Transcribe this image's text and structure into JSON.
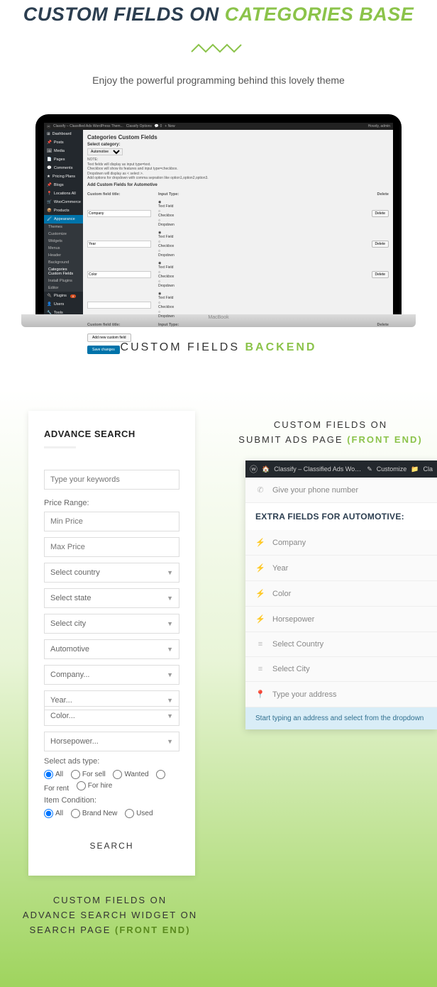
{
  "hero": {
    "title_prefix": "CUSTOM FIELDS ON ",
    "title_suffix": "CATEGORIES BASE",
    "subtitle": "Enjoy the powerful programming behind this lovely theme"
  },
  "laptop": {
    "macbook": "MacBook",
    "howdy": "Howdy, admin",
    "site": "Classify – Classified Ads WordPress Them...",
    "opts": "Classify Options",
    "new": "New",
    "sidebar": [
      "Dashboard",
      "Posts",
      "Media",
      "Pages",
      "Comments",
      "Pricing Plans",
      "Blogs",
      "Locations All",
      "WooCommerce",
      "Products",
      "Appearance"
    ],
    "submenu": [
      "Themes",
      "Customize",
      "Widgets",
      "Menus",
      "Header",
      "Background",
      "Categories Custom Fields",
      "Install Plugins",
      "Editor"
    ],
    "sidebar2": [
      "Plugins",
      "Users",
      "Tools"
    ],
    "page_title": "Categories Custom Fields",
    "select_cat": "Select category:",
    "cat_value": "Automotive",
    "note_head": "NOTE:",
    "note1": "Text fields will display as input type=text.",
    "note2": "Checkbox will show its features and input type=checkbox.",
    "note3": "Dropdown will display as < select >.",
    "note4": "Add options for dropdown with comma sepration like option1,option2,option3.",
    "add_head": "Add Custom Fields for Automotive",
    "th1": "Custom field title:",
    "th2": "Input Type:",
    "th3": "Delete",
    "rows": [
      {
        "title": "Company"
      },
      {
        "title": "Year"
      },
      {
        "title": "Color"
      },
      {
        "title": "Custom field title:"
      }
    ],
    "opt_text": "Text Field",
    "opt_chk": "Checkbox",
    "opt_dd": "Dropdown",
    "input_type": "Input Type:",
    "delete": "Delete",
    "add_btn": "Add new custom field",
    "save_btn": "Save changes"
  },
  "cap1": {
    "prefix": "CUSTOM FIELDS ",
    "suffix": "BACKEND"
  },
  "search": {
    "title": "ADVANCE SEARCH",
    "kw_ph": "Type your keywords",
    "pr_label": "Price Range:",
    "min_ph": "Min Price",
    "max_ph": "Max Price",
    "selects": [
      "Select country",
      "Select state",
      "Select city",
      "Automotive",
      "Company...",
      "Year...",
      "Color...",
      "Horsepower..."
    ],
    "ads_type": "Select ads type:",
    "ads_opts": [
      "All",
      "For sell",
      "Wanted",
      "For rent",
      "For hire"
    ],
    "cond_label": "Item Condition:",
    "cond_opts": [
      "All",
      "Brand New",
      "Used"
    ],
    "btn": "SEARCH"
  },
  "cap2": {
    "l1": "CUSTOM FIELDS ON",
    "l2": "ADVANCE SEARCH WIDGET ON",
    "l3": "SEARCH PAGE ",
    "suffix": "(FRONT END)"
  },
  "cap3": {
    "l1": "CUSTOM FIELDS ON",
    "l2": "SUBMIT ADS PAGE ",
    "suffix": "(FRONT END)"
  },
  "submit": {
    "site": "Classify – Classified Ads WordPress Them...",
    "customize": "Customize",
    "phone": "Give your phone number",
    "header": "EXTRA FIELDS FOR AUTOMOTIVE:",
    "company": "Company",
    "year": "Year",
    "color": "Color",
    "hp": "Horsepower",
    "country": "Select Country",
    "city": "Select City",
    "addr": "Type your address",
    "tip": "Start typing an address and select from the dropdown"
  }
}
